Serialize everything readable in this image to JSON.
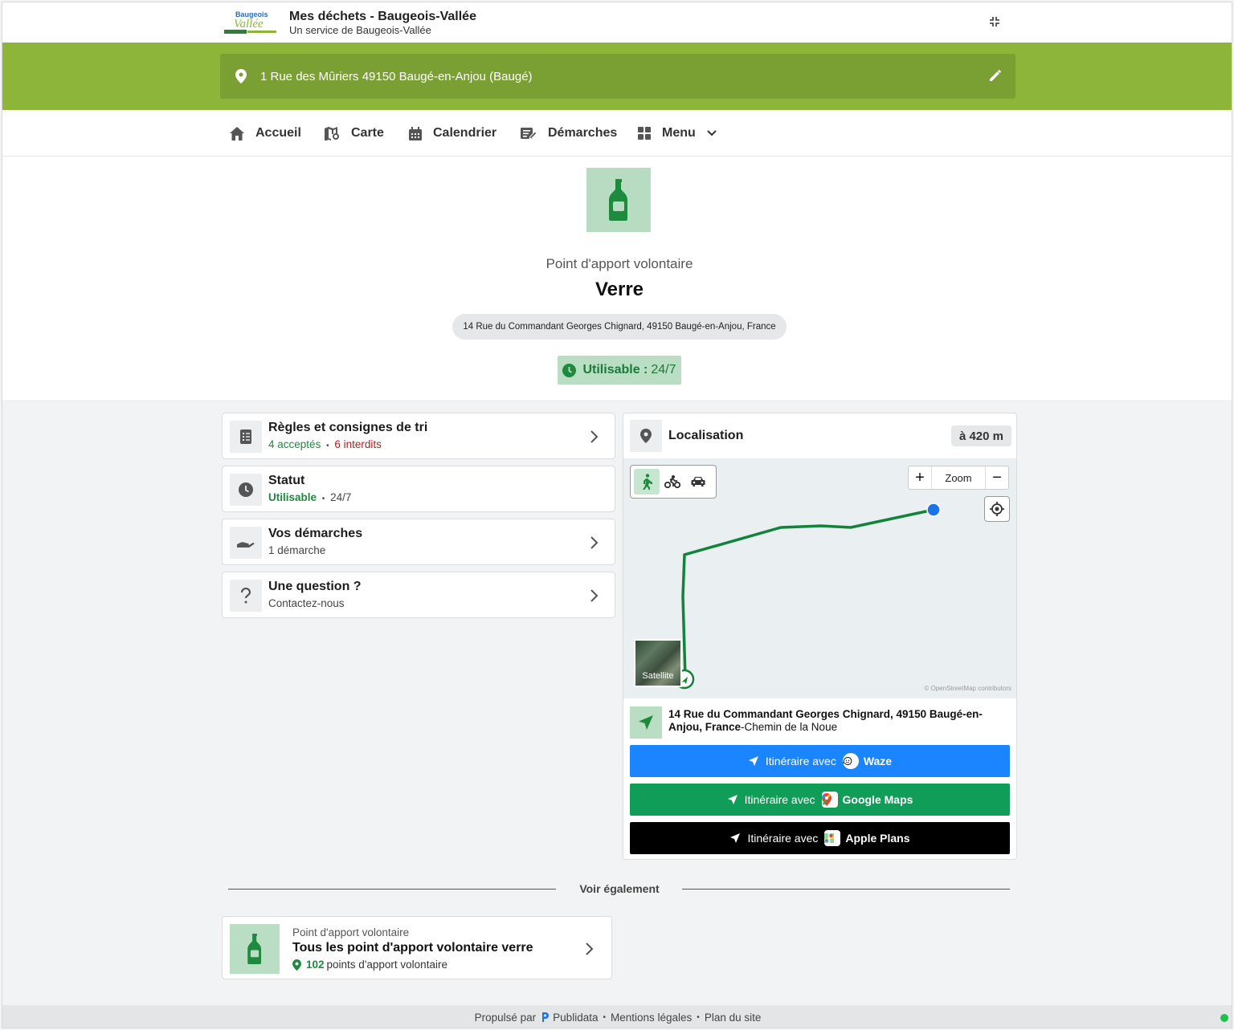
{
  "header": {
    "logo_text_top": "Baugeois",
    "logo_text_main": "Vallée",
    "title": "Mes déchets - Baugeois-Vallée",
    "subtitle": "Un service de Baugeois-Vallée",
    "shrink_icon": "compress-icon"
  },
  "address_bar": {
    "address": "1 Rue des Mûriers 49150 Baugé-en-Anjou (Baugé)",
    "pin_icon": "map-pin-icon",
    "edit_icon": "pencil-icon"
  },
  "nav": {
    "items": [
      {
        "label": "Accueil",
        "icon": "home-icon"
      },
      {
        "label": "Carte",
        "icon": "map-icon"
      },
      {
        "label": "Calendrier",
        "icon": "calendar-icon"
      },
      {
        "label": "Démarches",
        "icon": "edit-list-icon"
      },
      {
        "label": "Menu",
        "icon": "grid-icon"
      }
    ]
  },
  "hero": {
    "icon": "bottle-icon",
    "kicker": "Point d'apport volontaire",
    "title": "Verre",
    "address": "14 Rue du Commandant Georges Chignard, 49150 Baugé-en-Anjou, France",
    "status_label": "Utilisable :",
    "status_value": "24/7"
  },
  "cards": [
    {
      "title": "Règles et consignes de tri",
      "accepted_count": "4",
      "accepted_label": "acceptés",
      "separator": "•",
      "forbidden_count": "6",
      "forbidden_label": "interdits",
      "icon": "checklist-icon"
    },
    {
      "title": "Statut",
      "status": "Utilisable",
      "separator": "•",
      "hours": "24/7",
      "icon": "clock-icon"
    },
    {
      "title": "Vos démarches",
      "subtitle": "1 démarche",
      "icon": "hand-icon"
    },
    {
      "title": "Une question ?",
      "subtitle": "Contactez-nous",
      "icon": "question-icon"
    }
  ],
  "localisation": {
    "title": "Localisation",
    "distance": "à 420 m",
    "zoom_label": "Zoom",
    "zoom_in": "+",
    "zoom_out": "−",
    "satellite_label": "Satellite",
    "attribution": "© OpenStreetMap contributors",
    "modes": [
      "walk-icon",
      "bike-icon",
      "car-icon"
    ],
    "destination_bold": "14 Rue du Commandant Georges Chignard, 49150 Baugé-en-Anjou, France",
    "destination_rest": "-Chemin de la Noue",
    "buttons": [
      {
        "prefix": "Itinéraire avec",
        "brand": "Waze",
        "color": "#1a85ff"
      },
      {
        "prefix": "Itinéraire avec",
        "brand": "Google Maps",
        "color": "#109d58"
      },
      {
        "prefix": "Itinéraire avec",
        "brand": "Apple Plans",
        "color": "#000000"
      }
    ]
  },
  "see_also": {
    "label": "Voir également",
    "card": {
      "kicker": "Point d'apport volontaire",
      "title": "Tous les point d'apport volontaire verre",
      "count": "102",
      "count_label": "points d'apport volontaire"
    }
  },
  "footer": {
    "powered_by": "Propulsé par",
    "brand": "Publidata",
    "legal": "Mentions légales",
    "sitemap": "Plan du site",
    "separator": "•"
  },
  "colors": {
    "band_green": "#8db53a",
    "accent_green": "#1e8a3e",
    "waze_blue": "#1a85ff",
    "gmaps_green": "#109d58"
  }
}
